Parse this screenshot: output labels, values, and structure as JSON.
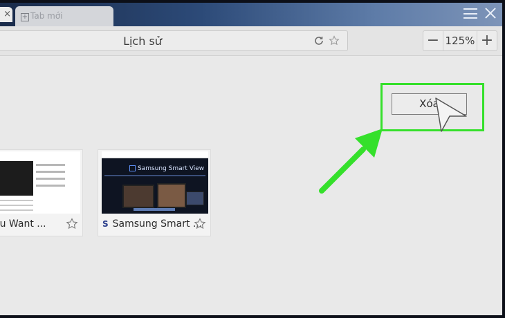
{
  "tabs": [
    {
      "label": "Tab mới"
    }
  ],
  "toolbar": {
    "title": "Lịch sử",
    "zoom": {
      "minus": "−",
      "value": "125%",
      "plus": "+"
    }
  },
  "history": [
    {
      "caption": "ve You Want ..."
    },
    {
      "caption": "Samsung Smart ...",
      "favicon": "S",
      "thumb_text": "Samsung Smart View"
    }
  ],
  "actions": {
    "delete_label": "Xóa"
  },
  "colors": {
    "highlight": "#35e02b",
    "tab_strip": "#2c4a78"
  }
}
